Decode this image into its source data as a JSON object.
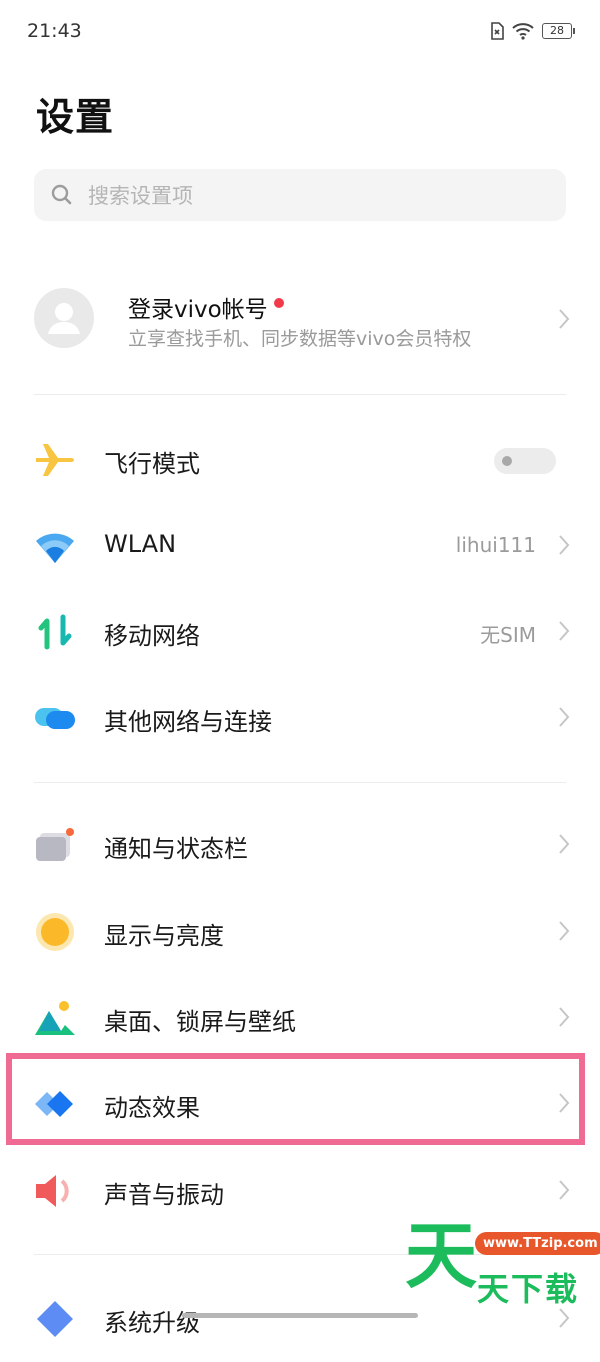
{
  "status_bar": {
    "time": "21:43",
    "battery": "28"
  },
  "page": {
    "title": "设置"
  },
  "search": {
    "placeholder": "搜索设置项"
  },
  "account": {
    "title": "登录vivo帐号",
    "subtitle": "立享查找手机、同步数据等vivo会员特权"
  },
  "items": [
    {
      "label": "飞行模式",
      "icon": "airplane-icon",
      "value": "",
      "control": "toggle",
      "toggle_on": false
    },
    {
      "label": "WLAN",
      "icon": "wifi-icon",
      "value": "lihui111"
    },
    {
      "label": "移动网络",
      "icon": "mobile-network-icon",
      "value": "无SIM"
    },
    {
      "label": "其他网络与连接",
      "icon": "connections-icon",
      "value": ""
    },
    {
      "label": "通知与状态栏",
      "icon": "notification-icon",
      "value": ""
    },
    {
      "label": "显示与亮度",
      "icon": "brightness-icon",
      "value": ""
    },
    {
      "label": "桌面、锁屏与壁纸",
      "icon": "wallpaper-icon",
      "value": ""
    },
    {
      "label": "动态效果",
      "icon": "animation-icon",
      "value": "",
      "highlighted": true
    },
    {
      "label": "声音与振动",
      "icon": "sound-icon",
      "value": ""
    },
    {
      "label": "系统升级",
      "icon": "system-update-icon",
      "value": ""
    }
  ],
  "watermark": {
    "big": "天",
    "url": "www.TTzip.com",
    "text": "天下载"
  },
  "colors": {
    "highlight": "#f06b94",
    "accent_red": "#f23a4a",
    "watermark_green": "#1cbc5c"
  }
}
